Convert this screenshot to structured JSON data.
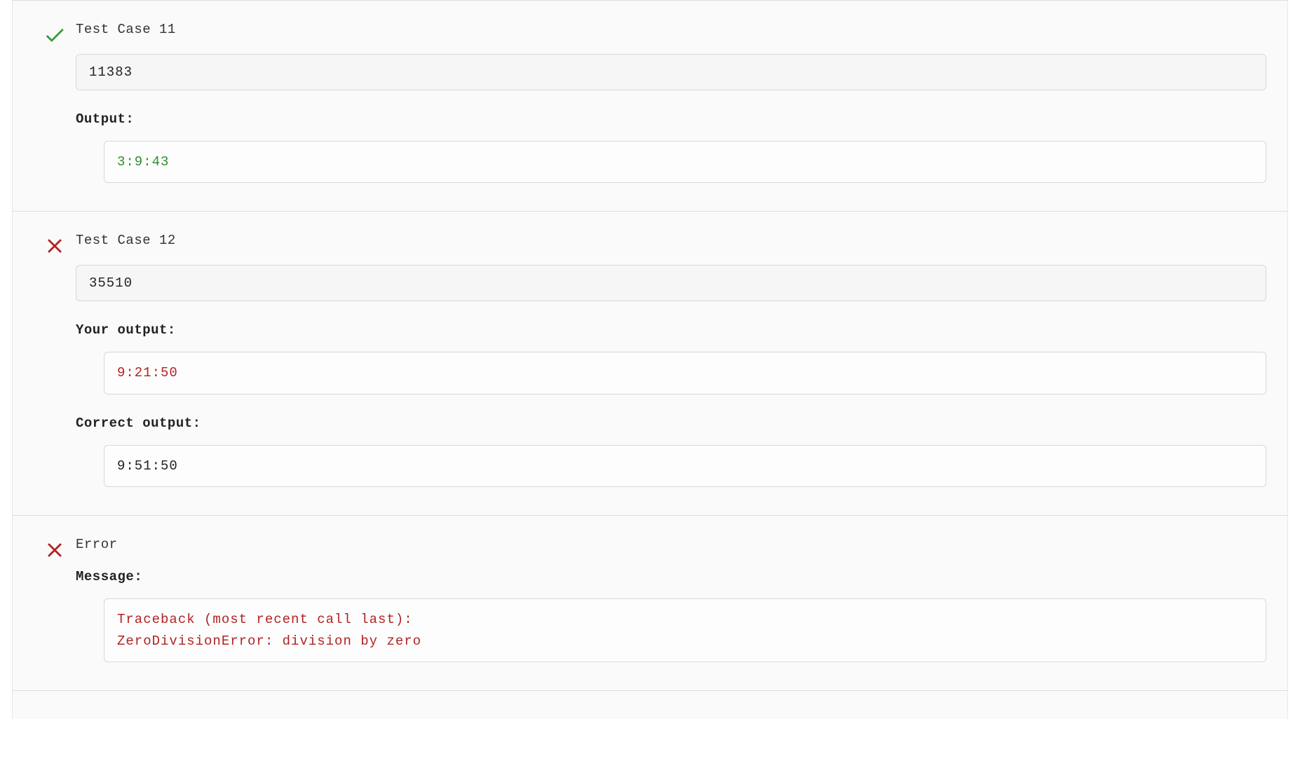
{
  "results": [
    {
      "status": "pass",
      "title": "Test Case 11",
      "input": "11383",
      "sections": [
        {
          "label": "Output:",
          "text": "3:9:43",
          "color": "green"
        }
      ]
    },
    {
      "status": "fail",
      "title": "Test Case 12",
      "input": "35510",
      "sections": [
        {
          "label": "Your output:",
          "text": "9:21:50",
          "color": "red"
        },
        {
          "label": "Correct output:",
          "text": "9:51:50",
          "color": "plain"
        }
      ]
    },
    {
      "status": "fail",
      "title": "Error",
      "input": null,
      "sections": [
        {
          "label": "Message:",
          "text": "Traceback (most recent call last):\nZeroDivisionError: division by zero",
          "color": "red"
        }
      ]
    }
  ]
}
